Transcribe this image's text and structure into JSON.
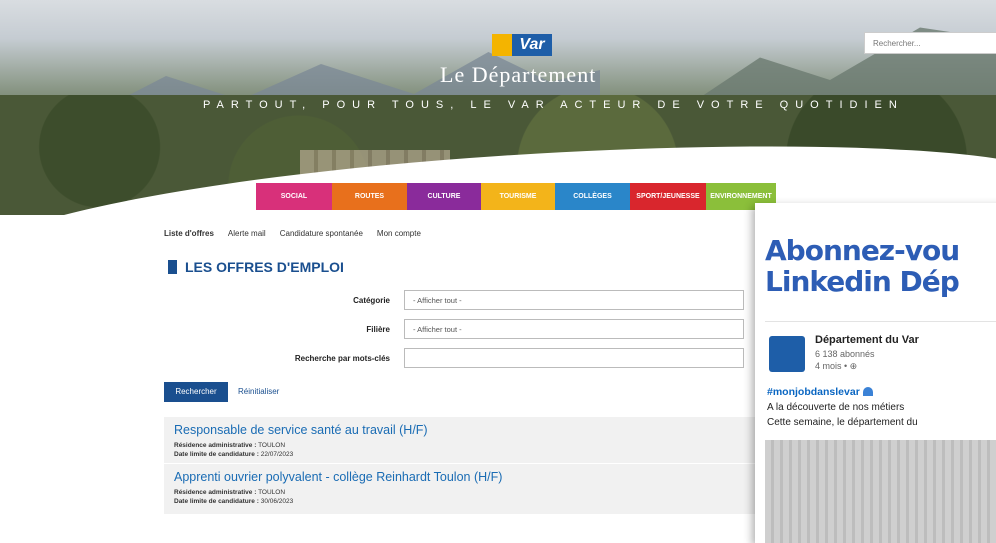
{
  "header": {
    "logo_text": "Var",
    "department_title": "Le Département",
    "tagline": "PARTOUT, POUR TOUS, LE VAR ACTEUR DE VOTRE QUOTIDIEN",
    "search_placeholder": "Rechercher..."
  },
  "menu": [
    {
      "label": "SOCIAL",
      "color": "#d8307a"
    },
    {
      "label": "ROUTES",
      "color": "#e8701c"
    },
    {
      "label": "CULTURE",
      "color": "#8a2b9b"
    },
    {
      "label": "TOURISME",
      "color": "#f3b41a"
    },
    {
      "label": "COLLÈGES",
      "color": "#2a86c9"
    },
    {
      "label": "SPORT/JEUNESSE",
      "color": "#d9262d"
    },
    {
      "label": "ENVIRONNEMENT",
      "color": "#8bbf3a"
    }
  ],
  "subnav": [
    "Liste d'offres",
    "Alerte mail",
    "Candidature spontanée",
    "Mon compte"
  ],
  "page_title": "LES OFFRES D'EMPLOI",
  "form": {
    "category_label": "Catégorie",
    "category_value": "- Afficher tout -",
    "filiere_label": "Filière",
    "filiere_value": "- Afficher tout -",
    "keywords_label": "Recherche par mots-clés",
    "keywords_value": "",
    "search_button": "Rechercher",
    "reset_button": "Réinitialiser"
  },
  "offers": [
    {
      "title": "Responsable de service santé au travail (H/F)",
      "residence_label": "Résidence administrative :",
      "residence": "TOULON",
      "deadline_label": "Date limite de candidature :",
      "deadline": "22/07/2023"
    },
    {
      "title": "Apprenti ouvrier polyvalent - collège Reinhardt Toulon (H/F)",
      "residence_label": "Résidence administrative :",
      "residence": "TOULON",
      "deadline_label": "Date limite de candidature :",
      "deadline": "30/06/2023"
    }
  ],
  "linkedin": {
    "headline_line1": "Abonnez-vou",
    "headline_line2": "Linkedin Dép",
    "page_name": "Département du Var",
    "followers": "6 138 abonnés",
    "time": "4 mois • ⊕",
    "hashtag": "#monjobdanslevar",
    "text1": "A la découverte de nos métiers",
    "text2": "Cette semaine, le département du"
  }
}
